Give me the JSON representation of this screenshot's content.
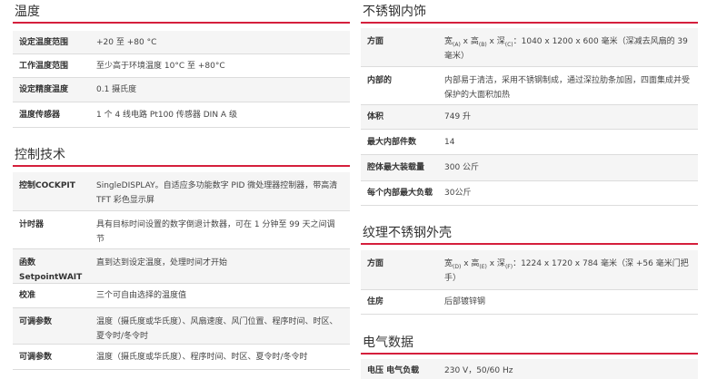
{
  "left": {
    "temperature": {
      "title": "温度",
      "rows": [
        {
          "label": "设定温度范围",
          "value": "+20 至 +80 °C"
        },
        {
          "label": "工作温度范围",
          "value": "至少高于环境温度 10°C 至 +80°C"
        },
        {
          "label": "设定精度温度",
          "value": "0.1 摄氏度"
        },
        {
          "label": "温度传感器",
          "value": "1 个 4 线电路 Pt100 传感器 DIN A 级"
        }
      ]
    },
    "control": {
      "title": "控制技术",
      "rows": [
        {
          "label": "控制COCKPIT",
          "value": "SingleDISPLAY。自适应多功能数字 PID 微处理器控制器，带高清 TFT 彩色显示屏"
        },
        {
          "label": "计时器",
          "value": "具有目标时间设置的数字倒退计数器，可在 1 分钟至 99 天之间调节"
        },
        {
          "label": "函数 SetpointWAIT",
          "value": "直到达到设定温度，处理时间才开始"
        },
        {
          "label": "校准",
          "value": "三个可自由选择的温度值"
        },
        {
          "label": "可调参数",
          "value": "温度（摄氏度或华氏度）、风扇速度、风门位置、程序时间、时区、夏令时/冬令时"
        },
        {
          "label": "可调参数",
          "value": "温度（摄氏度或华氏度）、程序时间、时区、夏令时/冬令时"
        }
      ]
    }
  },
  "right": {
    "interior": {
      "title": "不锈钢内饰",
      "rows": [
        {
          "label": "方面",
          "value_parts": [
            "宽",
            "(A)",
            " x 高",
            "(B)",
            " x 深",
            "(C)",
            "：1040 x 1200 x 600 毫米（深减去风扇的 39 毫米）"
          ]
        },
        {
          "label": "内部的",
          "value": "内部易于清洁，采用不锈钢制成，通过深拉肋条加固，四面集成并受保护的大面积加热"
        },
        {
          "label": "体积",
          "value": "749 升"
        },
        {
          "label": "最大内部件数",
          "value": "14"
        },
        {
          "label": "腔体最大装载量",
          "value": "300 公斤"
        },
        {
          "label": "每个内部最大负载",
          "value": "30公斤"
        }
      ]
    },
    "exterior": {
      "title": "纹理不锈钢外壳",
      "rows": [
        {
          "label": "方面",
          "value_parts": [
            "宽",
            "(D)",
            " x 高",
            "(E)",
            " x 深",
            "(F)",
            "：1224 x 1720 x 784 毫米（深 +56 毫米门把手）"
          ]
        },
        {
          "label": "住房",
          "value": "后部镀锌钢"
        }
      ]
    },
    "electrical": {
      "title": "电气数据",
      "rows": [
        {
          "label": "电压 电气负载",
          "value": "230 V，50/60 Hz"
        }
      ]
    }
  }
}
